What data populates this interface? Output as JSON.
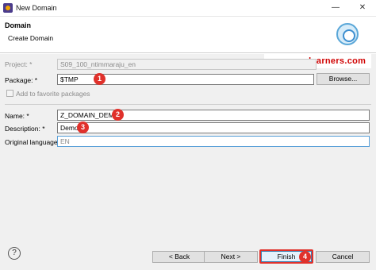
{
  "window": {
    "title": "New Domain",
    "minimize": "—",
    "close": "✕"
  },
  "header": {
    "title": "Domain",
    "subtitle": "Create Domain"
  },
  "watermark": "www.saplearners.com",
  "form": {
    "project_label": "Project: *",
    "project_value": "S09_100_ntimmaraju_en",
    "package_label": "Package: *",
    "package_value": "$TMP",
    "browse_label": "Browse...",
    "favorites_label": "Add to favorite packages",
    "name_label": "Name: *",
    "name_value": "Z_DOMAIN_DEMO",
    "description_label": "Description: *",
    "description_value": "Demo",
    "language_label": "Original language:",
    "language_value": "EN"
  },
  "badges": {
    "package": "1",
    "name": "2",
    "description": "3",
    "finish": "4"
  },
  "footer": {
    "help": "?",
    "back_label": "< Back",
    "next_label": "Next >",
    "finish_label": "Finish",
    "cancel_label": "Cancel"
  }
}
